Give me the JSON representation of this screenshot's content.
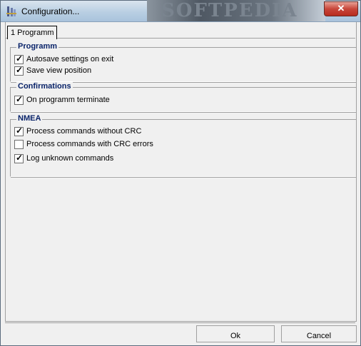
{
  "window": {
    "title": "Configuration..."
  },
  "tabs": [
    {
      "label": "1 Programm"
    }
  ],
  "groups": {
    "programm": {
      "title": "Programm",
      "items": [
        {
          "label": "Autosave settings on exit",
          "checked": true
        },
        {
          "label": "Save view position",
          "checked": true
        }
      ]
    },
    "confirmations": {
      "title": "Confirmations",
      "items": [
        {
          "label": "On programm terminate",
          "checked": true
        }
      ]
    },
    "nmea": {
      "title": "NMEA",
      "items": [
        {
          "label": "Process commands without CRC",
          "checked": true
        },
        {
          "label": "Process commands with CRC errors",
          "checked": false
        },
        {
          "label": "Log unknown commands",
          "checked": true
        }
      ]
    }
  },
  "buttons": {
    "ok": "Ok",
    "cancel": "Cancel"
  },
  "watermark": "SOFTPEDIA",
  "icons": {
    "title": "settings-icon",
    "close": "close-icon"
  }
}
